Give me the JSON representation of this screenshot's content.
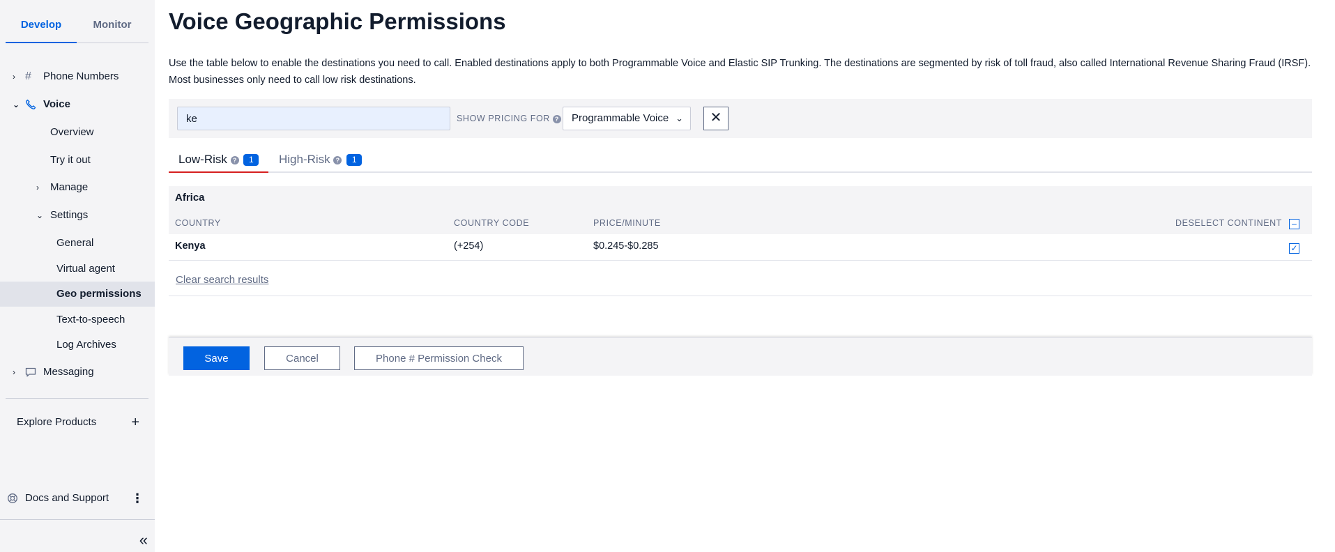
{
  "sidebar": {
    "tabs": [
      {
        "label": "Develop",
        "active": true
      },
      {
        "label": "Monitor",
        "active": false
      }
    ],
    "phone_numbers": "Phone Numbers",
    "voice": "Voice",
    "overview": "Overview",
    "try_it_out": "Try it out",
    "manage": "Manage",
    "settings": "Settings",
    "general": "General",
    "virtual_agent": "Virtual agent",
    "geo_permissions": "Geo permissions",
    "text_to_speech": "Text-to-speech",
    "log_archives": "Log Archives",
    "messaging": "Messaging",
    "explore_products": "Explore Products",
    "docs_and_support": "Docs and Support"
  },
  "page": {
    "title": "Voice Geographic Permissions",
    "description": "Use the table below to enable the destinations you need to call. Enabled destinations apply to both Programmable Voice and Elastic SIP Trunking. The destinations are segmented by risk of toll fraud, also called International Revenue Sharing Fraud (IRSF). Most businesses only need to call low risk destinations."
  },
  "filter": {
    "search_value": "ke",
    "pricing_label": "SHOW PRICING FOR",
    "pricing_selected": "Programmable Voice"
  },
  "risk_tabs": [
    {
      "label": "Low-Risk",
      "count": "1",
      "active": true
    },
    {
      "label": "High-Risk",
      "count": "1",
      "active": false
    }
  ],
  "table": {
    "continent": "Africa",
    "headers": {
      "country": "COUNTRY",
      "country_code": "COUNTRY CODE",
      "price_minute": "PRICE/MINUTE",
      "deselect_continent": "DESELECT CONTINENT"
    },
    "rows": [
      {
        "country": "Kenya",
        "code": "(+254)",
        "price": "$0.245-$0.285",
        "checked": true
      }
    ],
    "clear_search": "Clear search results"
  },
  "actions": {
    "save": "Save",
    "cancel": "Cancel",
    "permission_check": "Phone # Permission Check"
  },
  "colors": {
    "accent": "#0263e0",
    "active_tab_underline": "#d61f1f",
    "sidebar_bg": "#f4f4f6"
  }
}
